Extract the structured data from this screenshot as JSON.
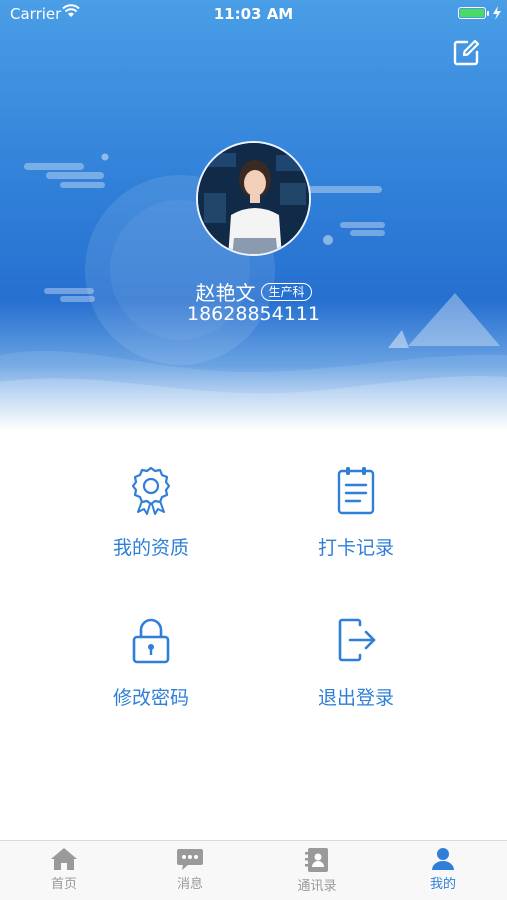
{
  "status_bar": {
    "carrier": "Carrier",
    "time": "11:03 AM"
  },
  "profile": {
    "name": "赵艳文",
    "department": "生产科",
    "phone": "18628854111"
  },
  "menu": [
    {
      "label": "我的资质",
      "icon": "certificate-badge-icon"
    },
    {
      "label": "打卡记录",
      "icon": "clipboard-icon"
    },
    {
      "label": "修改密码",
      "icon": "lock-icon"
    },
    {
      "label": "退出登录",
      "icon": "logout-icon"
    }
  ],
  "tabs": [
    {
      "label": "首页",
      "icon": "home-icon"
    },
    {
      "label": "消息",
      "icon": "message-icon"
    },
    {
      "label": "通讯录",
      "icon": "contacts-icon"
    },
    {
      "label": "我的",
      "icon": "user-icon",
      "active": true
    }
  ],
  "colors": {
    "accent": "#2f7fd8",
    "header_blue": "#2670d0",
    "tab_inactive": "#9a9a9a"
  }
}
